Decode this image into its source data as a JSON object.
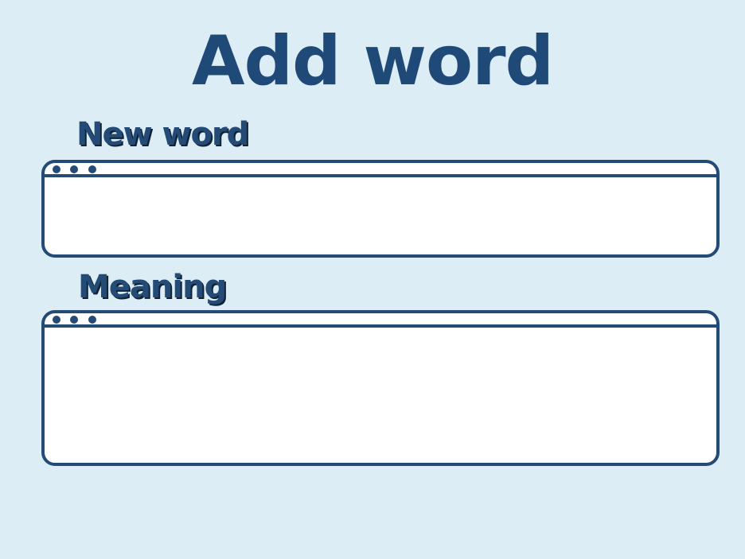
{
  "page": {
    "title": "Add word"
  },
  "new_word": {
    "label": "New word",
    "value": "",
    "placeholder": "",
    "window_icons": [
      "window-dot-icon",
      "window-dot-icon",
      "window-dot-icon"
    ]
  },
  "meaning": {
    "label": "Meaning",
    "value": "",
    "placeholder": "",
    "window_icons": [
      "window-dot-icon",
      "window-dot-icon",
      "window-dot-icon"
    ]
  },
  "colors": {
    "background": "#dcedf5",
    "accent": "#234b75",
    "title": "#1f4a78",
    "field_background": "#ffffff"
  }
}
